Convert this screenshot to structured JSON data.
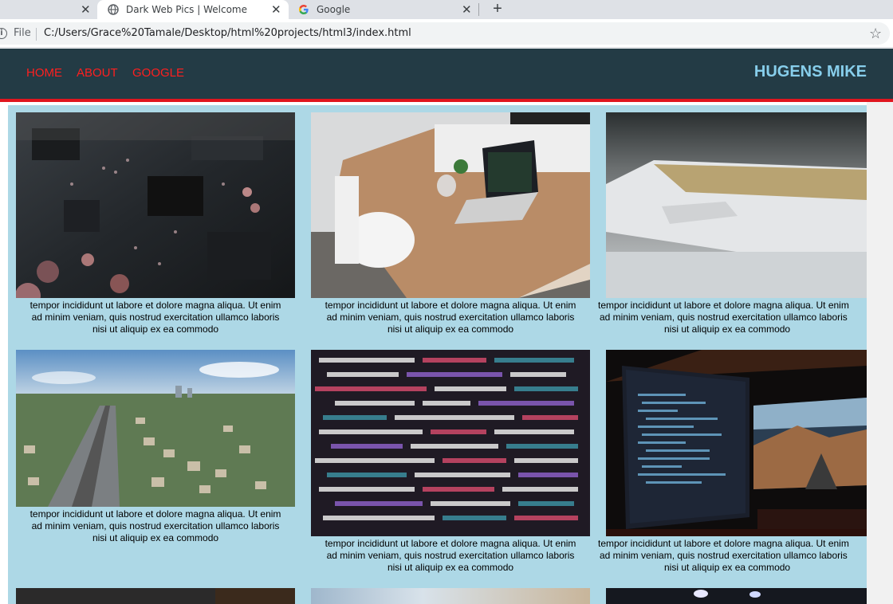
{
  "browser": {
    "tabs": [
      {
        "title": "",
        "active": false
      },
      {
        "title": "Dark Web Pics | Welcome",
        "active": true
      },
      {
        "title": "Google",
        "active": false
      }
    ],
    "address_scheme_label": "File",
    "url": "C:/Users/Grace%20Tamale/Desktop/html%20projects/html3/index.html"
  },
  "page": {
    "nav": [
      {
        "label": "HOME"
      },
      {
        "label": "ABOUT"
      },
      {
        "label": "GOOGLE"
      }
    ],
    "brand": "HUGENS MIKE",
    "caption_lines": [
      "tempor incididunt ut labore et dolore magna aliqua. Ut enim",
      "ad minim veniam, quis nostrud exercitation ullamco laboris",
      "nisi ut aliquip ex ea commodo"
    ],
    "images": [
      {
        "subject": "circuit board"
      },
      {
        "subject": "laptop on wooden desk"
      },
      {
        "subject": "laptop closeup"
      },
      {
        "subject": "aerial city highway"
      },
      {
        "subject": "code on screen"
      },
      {
        "subject": "monitors with code"
      }
    ],
    "colors": {
      "navbar": "#233b45",
      "nav_link": "#ff1f1f",
      "brand": "#87ceeb",
      "accent_border": "#e0161f",
      "gallery_bg": "#add8e6"
    }
  }
}
